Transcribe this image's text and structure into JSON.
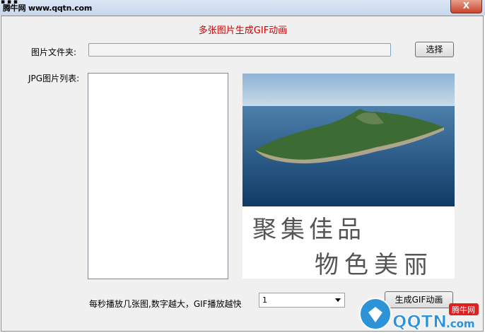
{
  "titlebar": {
    "watermark": "腾牛网 www.qqtn.com",
    "close_glyph": "X"
  },
  "app": {
    "title": "多张图片生成GIF动画",
    "folder_label": "图片文件夹:",
    "folder_value": "",
    "choose_button": "选择",
    "list_label": "JPG图片列表:",
    "speed_label": "每秒播放几张图,数字越大，GIF播放越快",
    "speed_value": "1",
    "generate_button": "生成GIF动画"
  },
  "preview": {
    "calligraphy_line1": "聚集佳品",
    "calligraphy_line2": "物色美丽"
  },
  "logo": {
    "brand": "QQTN",
    "domain": ".com",
    "badge": "腾牛网"
  },
  "colors": {
    "title_red": "#cc0000",
    "sea_top": "#7ea3c6",
    "sea_bottom": "#0f3a66",
    "island": "#3d6b34",
    "logo_blue": "#2c93d8",
    "logo_badge": "#e02020"
  }
}
